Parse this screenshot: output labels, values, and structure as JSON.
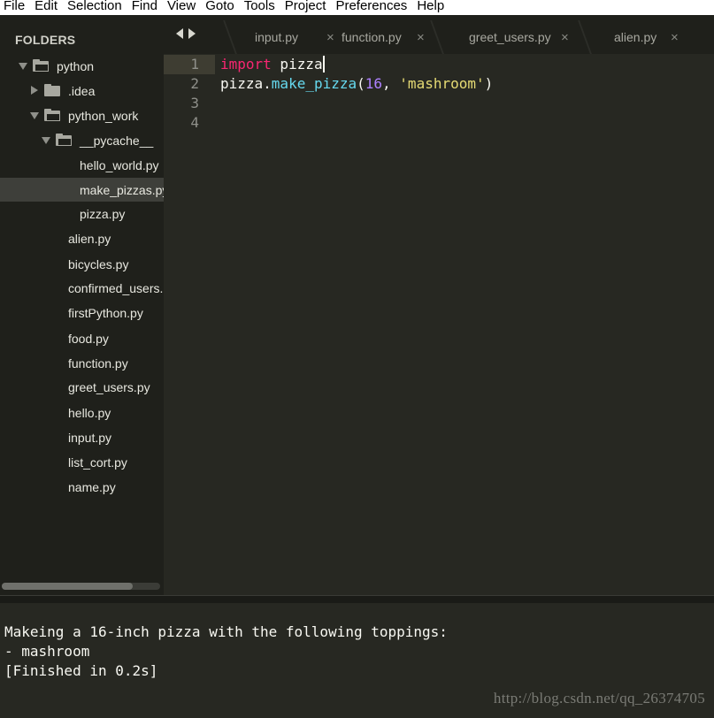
{
  "menu": [
    "File",
    "Edit",
    "Selection",
    "Find",
    "View",
    "Goto",
    "Tools",
    "Project",
    "Preferences",
    "Help"
  ],
  "sidebar": {
    "header": "FOLDERS",
    "tree": [
      {
        "label": "python",
        "type": "folder",
        "state": "open"
      },
      {
        "label": ".idea",
        "type": "folder",
        "state": "closed"
      },
      {
        "label": "python_work",
        "type": "folder",
        "state": "open"
      },
      {
        "label": "__pycache__",
        "type": "folder",
        "state": "open"
      },
      {
        "label": "hello_world.py",
        "type": "file"
      },
      {
        "label": "make_pizzas.py",
        "type": "file",
        "selected": true
      },
      {
        "label": "pizza.py",
        "type": "file"
      },
      {
        "label": "alien.py",
        "type": "file"
      },
      {
        "label": "bicycles.py",
        "type": "file"
      },
      {
        "label": "confirmed_users.py",
        "type": "file"
      },
      {
        "label": "firstPython.py",
        "type": "file"
      },
      {
        "label": "food.py",
        "type": "file"
      },
      {
        "label": "function.py",
        "type": "file"
      },
      {
        "label": "greet_users.py",
        "type": "file"
      },
      {
        "label": "hello.py",
        "type": "file"
      },
      {
        "label": "input.py",
        "type": "file"
      },
      {
        "label": "list_cort.py",
        "type": "file"
      },
      {
        "label": "name.py",
        "type": "file"
      }
    ]
  },
  "tabs": [
    {
      "label": "input.py",
      "close": "×"
    },
    {
      "label": "function.py",
      "close": "×"
    },
    {
      "label": "greet_users.py",
      "close": "×"
    },
    {
      "label": "alien.py",
      "close": "×"
    }
  ],
  "editor": {
    "line_numbers": [
      "1",
      "2",
      "3",
      "4"
    ],
    "line1": {
      "kw": "import",
      "rest": " pizza"
    },
    "line2": {
      "obj": "pizza.",
      "fn": "make_pizza",
      "open": "(",
      "num": "16",
      "comma": ", ",
      "str": "'mashroom'",
      "close": ")"
    }
  },
  "output": {
    "lines": [
      "Makeing a 16-inch pizza with the following toppings:",
      "- mashroom",
      "[Finished in 0.2s]"
    ]
  },
  "watermark": "http://blog.csdn.net/qq_26374705",
  "colors": {
    "keyword": "#f92672",
    "function": "#66d9ef",
    "number": "#ae81ff",
    "string": "#e6db74",
    "background": "#272822",
    "sidebar": "#1f201b"
  }
}
